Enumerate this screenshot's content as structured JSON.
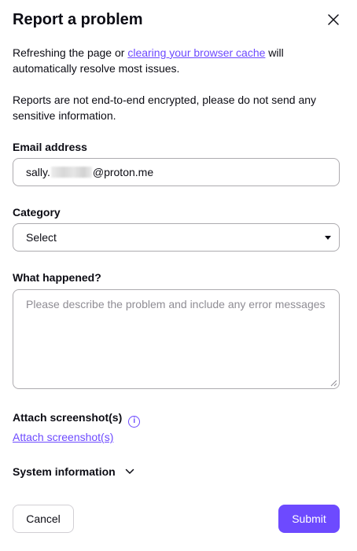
{
  "dialog": {
    "title": "Report a problem",
    "close_icon": "close-icon"
  },
  "intro": {
    "text_before": "Refreshing the page or ",
    "link": "clearing your browser cache",
    "text_after": " will automatically resolve most issues."
  },
  "warning": "Reports are not end-to-end encrypted, please do not send any sensitive information.",
  "email": {
    "label": "Email address",
    "value_prefix": "sally.",
    "value_suffix": "@proton.me"
  },
  "category": {
    "label": "Category",
    "selected": "Select"
  },
  "description": {
    "label": "What happened?",
    "placeholder": "Please describe the problem and include any error messages"
  },
  "attachments": {
    "label": "Attach screenshot(s)",
    "link": "Attach screenshot(s)",
    "info_icon": "info-icon"
  },
  "system_info": {
    "label": "System information",
    "icon": "chevron-down-icon"
  },
  "actions": {
    "cancel": "Cancel",
    "submit": "Submit"
  },
  "colors": {
    "accent": "#6d4aff",
    "text": "#0c0c14",
    "border": "#adabaf",
    "placeholder": "#8f8d94"
  }
}
